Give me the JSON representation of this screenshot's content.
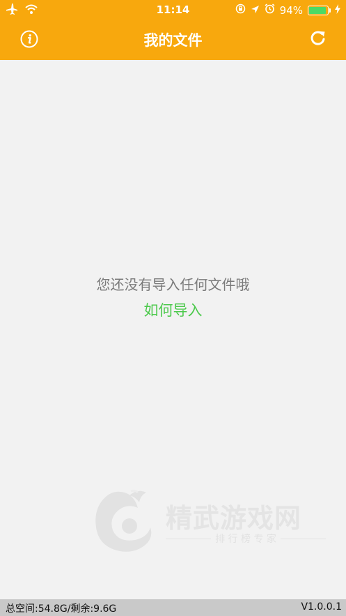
{
  "status_bar": {
    "time": "11:14",
    "battery_percent": "94%",
    "battery_level": 0.94,
    "icons": [
      "airplane-icon",
      "wifi-icon",
      "orientation-lock-icon",
      "location-icon",
      "alarm-icon",
      "charging-icon"
    ]
  },
  "navbar": {
    "title": "我的文件",
    "left_icon": "info-icon",
    "right_icon": "refresh-icon"
  },
  "empty_state": {
    "message": "您还没有导入任何文件哦",
    "link": "如何导入"
  },
  "watermark": {
    "title": "精武游戏网",
    "subtitle": "排 行 榜 专 家"
  },
  "footer": {
    "storage": "总空间:54.8G/剩余:9.6G",
    "version": "V1.0.0.1"
  },
  "colors": {
    "accent": "#f8a80d",
    "link": "#4cc94c",
    "battery": "#4cd964",
    "background": "#f2f2f2"
  }
}
